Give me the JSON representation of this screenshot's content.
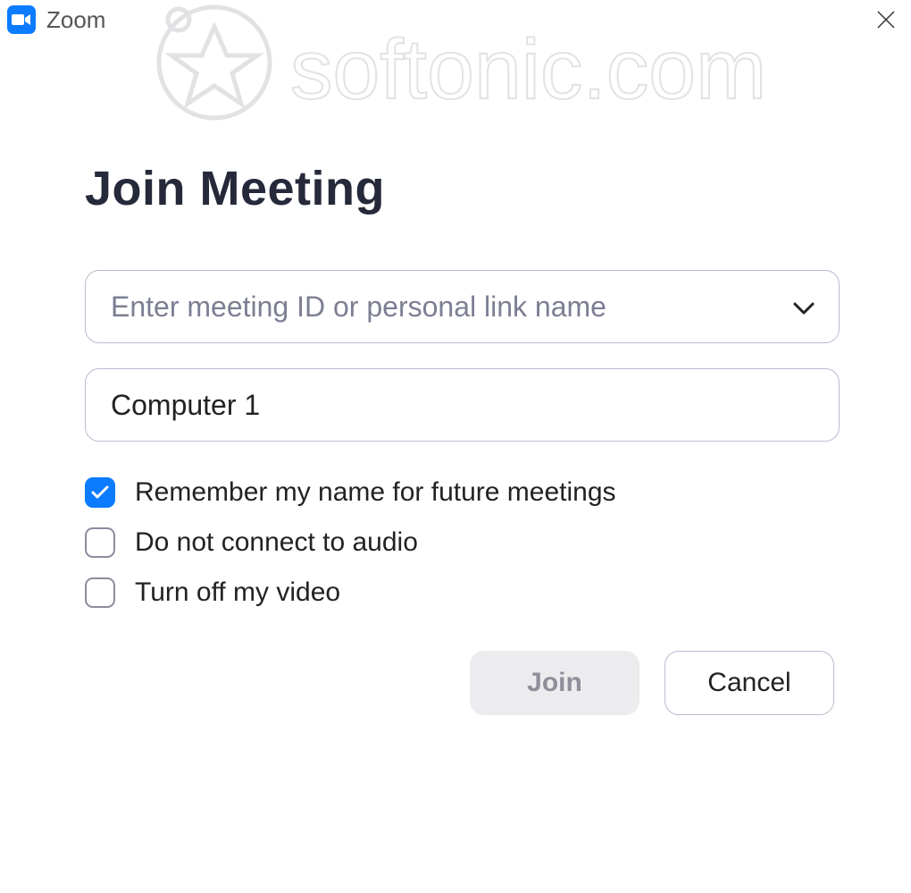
{
  "titlebar": {
    "app_title": "Zoom"
  },
  "watermark_text": "softonic.com",
  "dialog": {
    "heading": "Join Meeting",
    "meeting_id": {
      "placeholder": "Enter meeting ID or personal link name",
      "value": ""
    },
    "name": {
      "value": "Computer 1"
    },
    "options": [
      {
        "label": "Remember my name for future meetings",
        "checked": true
      },
      {
        "label": "Do not connect to audio",
        "checked": false
      },
      {
        "label": "Turn off my video",
        "checked": false
      }
    ],
    "buttons": {
      "join": "Join",
      "cancel": "Cancel"
    }
  }
}
